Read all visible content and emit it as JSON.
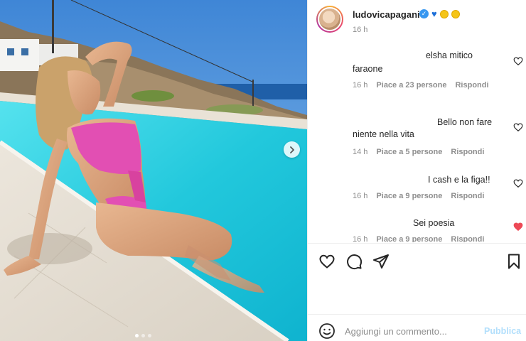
{
  "post": {
    "username": "ludovicapagani",
    "badge_emojis": [
      "verified-badge",
      "blue-heart",
      "yellow-circle",
      "yellow-circle"
    ],
    "time": "16 h"
  },
  "comments": [
    {
      "text_line1": "elsha mitico",
      "text_line2": "faraone",
      "time": "16 h",
      "likes": "Piace a 23 persone",
      "reply": "Rispondi",
      "liked": false
    },
    {
      "text_line1": "Bello non fare",
      "text_line2": "niente nella vita",
      "time": "14 h",
      "likes": "Piace a 5 persone",
      "reply": "Rispondi",
      "liked": false
    },
    {
      "text_line1": "I cash e la figa!!",
      "text_line2": "",
      "time": "16 h",
      "likes": "Piace a 9 persone",
      "reply": "Rispondi",
      "liked": false
    },
    {
      "text_line1": "Sei poesia",
      "text_line2": "",
      "time": "16 h",
      "likes": "Piace a 9 persone",
      "reply": "Rispondi",
      "liked": true
    }
  ],
  "composer": {
    "placeholder": "Aggiungi un commento...",
    "publish": "Pubblica"
  },
  "carousel": {
    "count": 3,
    "active_index": 1
  },
  "colors": {
    "like_red": "#ed4956",
    "pool": "#2fd0e0",
    "sky": "#4a90d9",
    "publish_disabled": "#b2dffc"
  }
}
